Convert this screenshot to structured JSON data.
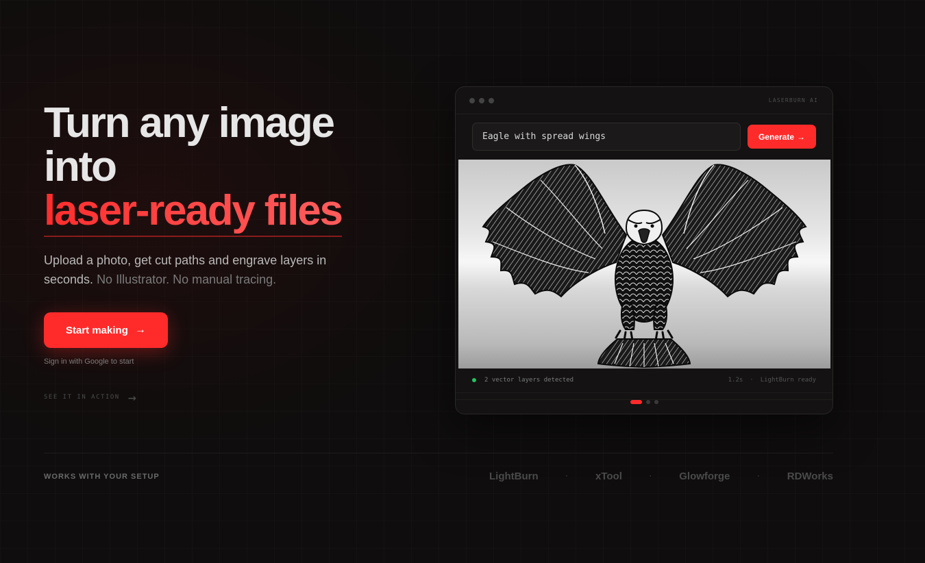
{
  "hero": {
    "headline_line1": "Turn any image",
    "headline_line2": "into",
    "headline_accent": "laser-ready files",
    "subtitle_main": "Upload a photo, get cut paths and engrave layers in seconds.",
    "subtitle_muted": "No Illustrator. No manual tracing.",
    "cta_label": "Start making",
    "cta_arrow": "→",
    "signin_note": "Sign in with Google to start",
    "see_action_label": "SEE IT IN ACTION",
    "see_action_arrow": "→"
  },
  "demo": {
    "window_title": "LASERBURN AI",
    "prompt_value": "Eagle with spread wings",
    "generate_label": "Generate",
    "generate_arrow": "→",
    "status_text": "2 vector layers detected",
    "status_time": "1.2s",
    "status_sep": "·",
    "status_ready": "LightBurn ready",
    "carousel": {
      "pages": 3,
      "active": 1
    },
    "status_color": "#22c55e"
  },
  "footer": {
    "works_label": "WORKS WITH YOUR SETUP",
    "partners": [
      "LightBurn",
      "xTool",
      "Glowforge",
      "RDWorks"
    ],
    "sep": "·"
  },
  "colors": {
    "accent": "#ff2b2b",
    "background": "#0f0d0d"
  }
}
